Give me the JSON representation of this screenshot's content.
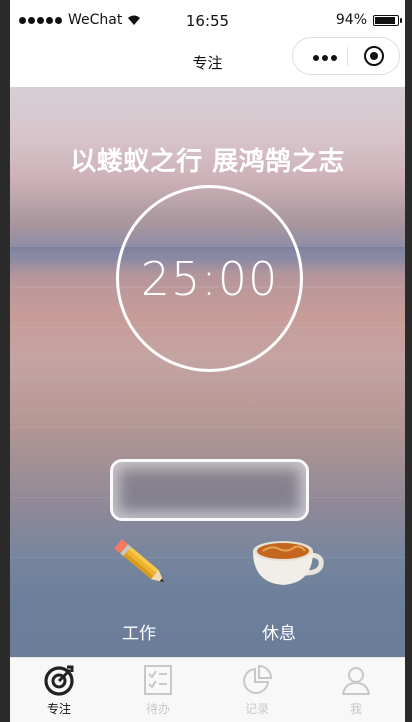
{
  "status_bar": {
    "carrier": "WeChat",
    "time": "16:55",
    "battery": "94%",
    "battery_level": 0.94
  },
  "nav": {
    "title": "专注"
  },
  "main": {
    "motto": "以蝼蚁之行 展鸿鹄之志",
    "timer": "25:00",
    "modes": [
      {
        "label": "工作",
        "icon": "pencil-icon"
      },
      {
        "label": "休息",
        "icon": "coffee-cup-icon"
      }
    ]
  },
  "tabs": [
    {
      "label": "专注",
      "icon": "focus-target-icon",
      "active": true
    },
    {
      "label": "待办",
      "icon": "todo-list-icon",
      "active": false
    },
    {
      "label": "记录",
      "icon": "pie-chart-icon",
      "active": false
    },
    {
      "label": "我",
      "icon": "user-icon",
      "active": false
    }
  ],
  "colors": {
    "accent_active": "#111111",
    "tab_inactive": "#c8c8c8",
    "text_on_scene": "#ffffff"
  }
}
